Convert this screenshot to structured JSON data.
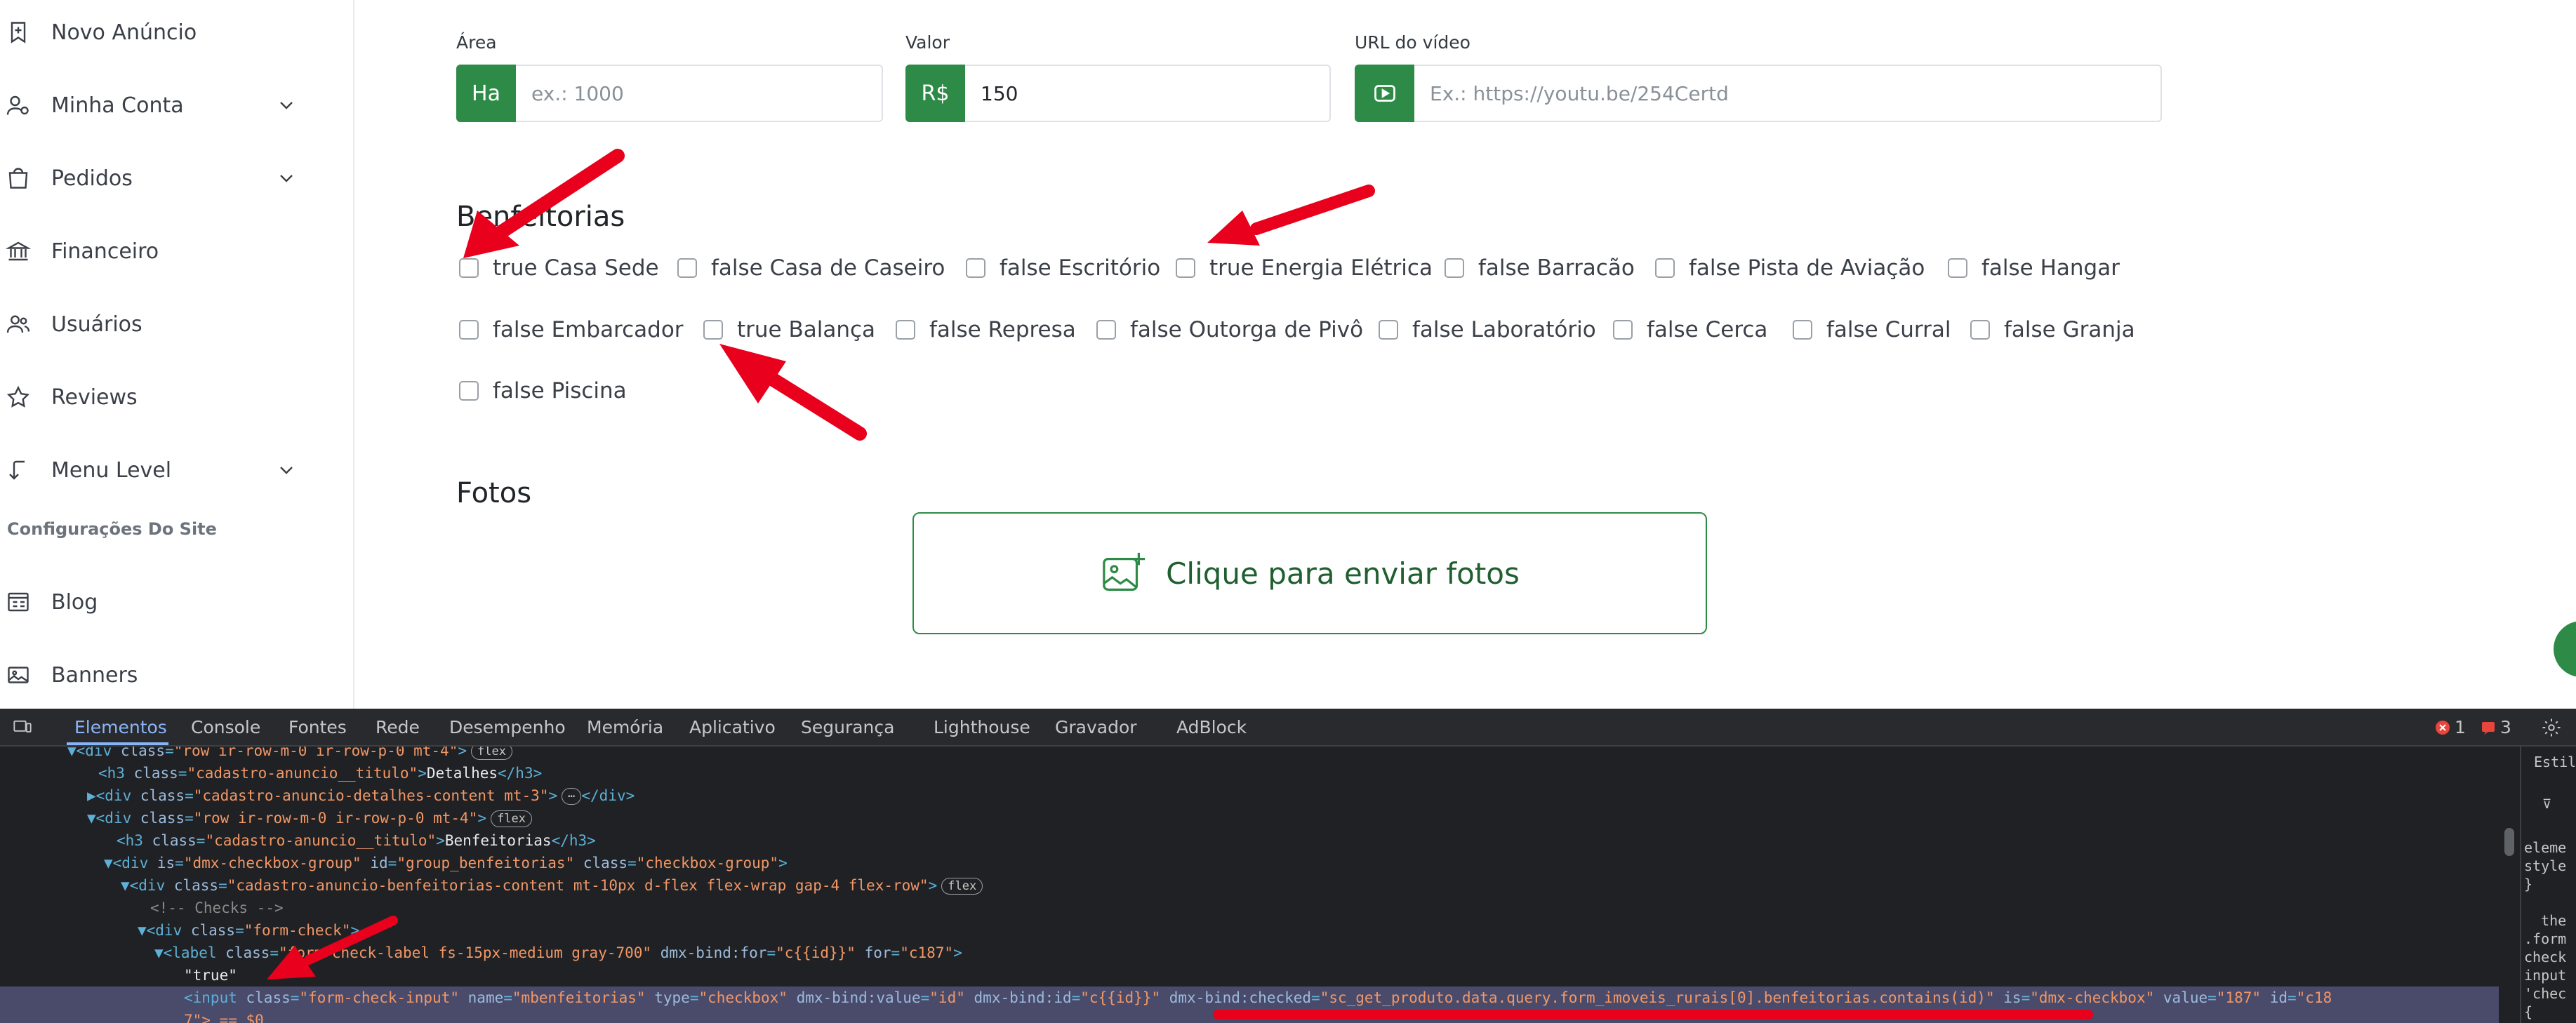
{
  "sidebar": {
    "items": [
      {
        "label": "Novo Anúncio",
        "icon": "bookmark-icon"
      },
      {
        "label": "Minha Conta",
        "icon": "user-settings-icon"
      },
      {
        "label": "Pedidos",
        "icon": "shopping-bag-icon"
      },
      {
        "label": "Financeiro",
        "icon": "bank-icon"
      },
      {
        "label": "Usuários",
        "icon": "users-icon"
      },
      {
        "label": "Reviews",
        "icon": "star-icon"
      },
      {
        "label": "Menu Level",
        "icon": "level-down-icon"
      },
      {
        "label": "Blog",
        "icon": "blog-icon"
      },
      {
        "label": "Banners",
        "icon": "image-icon"
      }
    ],
    "section_label": "Configurações Do Site"
  },
  "form": {
    "area": {
      "label": "Área",
      "prefix": "Ha",
      "placeholder": "ex.: 1000"
    },
    "valor": {
      "label": "Valor",
      "prefix": "R$",
      "value": "150"
    },
    "video": {
      "label": "URL do vídeo",
      "placeholder": "Ex.: https://youtu.be/254Certd"
    }
  },
  "benfeitorias": {
    "title": "Benfeitorias",
    "options": [
      "true Casa Sede",
      "false Casa de Caseiro",
      "false Escritório",
      "true Energia Elétrica",
      "false Barracão",
      "false Pista de Aviação",
      "false Hangar",
      "false Embarcador",
      "true Balança",
      "false Represa",
      "false Outorga de Pivô",
      "false Laboratório",
      "false Cerca",
      "false Curral",
      "false Granja",
      "false Piscina"
    ]
  },
  "fotos": {
    "title": "Fotos",
    "upload_label": "Clique para enviar fotos"
  },
  "devtools": {
    "tabs": [
      "Elementos",
      "Console",
      "Fontes",
      "Rede",
      "Desempenho",
      "Memória",
      "Aplicativo",
      "Segurança",
      "Lighthouse",
      "Gravador",
      "AdBlock"
    ],
    "errors": "1",
    "warnings": "3",
    "styles_tab": "Estilo",
    "code": {
      "l1_class": "row ir-row-m-0 ir-row-p-0 mt-4",
      "l2_class": "cadastro-anuncio__titulo",
      "l2_text": "Detalhes",
      "l3_class": "cadastro-anuncio-detalhes-content mt-3",
      "l4_class": "row ir-row-m-0 ir-row-p-0 mt-4",
      "l5_class": "cadastro-anuncio__titulo",
      "l5_text": "Benfeitorias",
      "l6_is": "dmx-checkbox-group",
      "l6_id": "group_benfeitorias",
      "l6_class": "checkbox-group",
      "l7_class": "cadastro-anuncio-benfeitorias-content mt-10px d-flex flex-wrap gap-4 flex-row",
      "l8_comment": "<!-- Checks -->",
      "l9_class": "form-check",
      "l10_class": "form-check-label fs-15px-medium gray-700",
      "l10_bind_for": "c{{id}}",
      "l10_for": "c187",
      "l11_text": "\"true\"",
      "l12_class": "form-check-input",
      "l12_name": "mbenfeitorias",
      "l12_type": "checkbox",
      "l12_bind_value": "id",
      "l12_bind_id": "c{{id}}",
      "l12_bind_checked": "sc_get_produto.data.query.form_imoveis_rurais[0].benfeitorias.contains(id)",
      "l12_is": "dmx-checkbox",
      "l12_value": "187",
      "l12_id": "c18",
      "l13_text": "7\"> == $0",
      "badge_flex": "flex",
      "ellipsis": "⋯"
    },
    "styles_pane": [
      "eleme",
      "style",
      "}",
      "",
      "  the",
      ".form",
      "check",
      "input",
      "'chec",
      "{"
    ]
  },
  "colors": {
    "accent": "#2e8b47",
    "annotation": "#e8001c"
  }
}
